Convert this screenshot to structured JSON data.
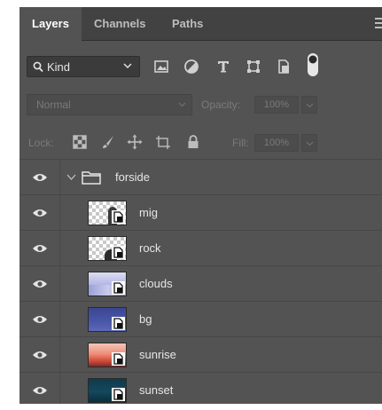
{
  "tabs": [
    {
      "label": "Layers",
      "active": true
    },
    {
      "label": "Channels",
      "active": false
    },
    {
      "label": "Paths",
      "active": false
    }
  ],
  "filter": {
    "kind_label": "Kind",
    "icons": [
      "pixel-filter-icon",
      "adjustment-filter-icon",
      "type-filter-icon",
      "shape-filter-icon",
      "smart-object-filter-icon",
      "filter-toggle-icon"
    ]
  },
  "blend": {
    "mode": "Normal",
    "opacity_label": "Opacity:",
    "opacity_value": "100%"
  },
  "lock": {
    "label": "Lock:",
    "fill_label": "Fill:",
    "fill_value": "100%"
  },
  "group": {
    "name": "forside",
    "expanded": true
  },
  "layers": [
    {
      "name": "mig",
      "thumb": "transparent-figure"
    },
    {
      "name": "rock",
      "thumb": "transparent-rock"
    },
    {
      "name": "clouds",
      "thumb": "clouds"
    },
    {
      "name": "bg",
      "thumb": "blue"
    },
    {
      "name": "sunrise",
      "thumb": "sunrise"
    },
    {
      "name": "sunset",
      "thumb": "dark-teal"
    }
  ]
}
